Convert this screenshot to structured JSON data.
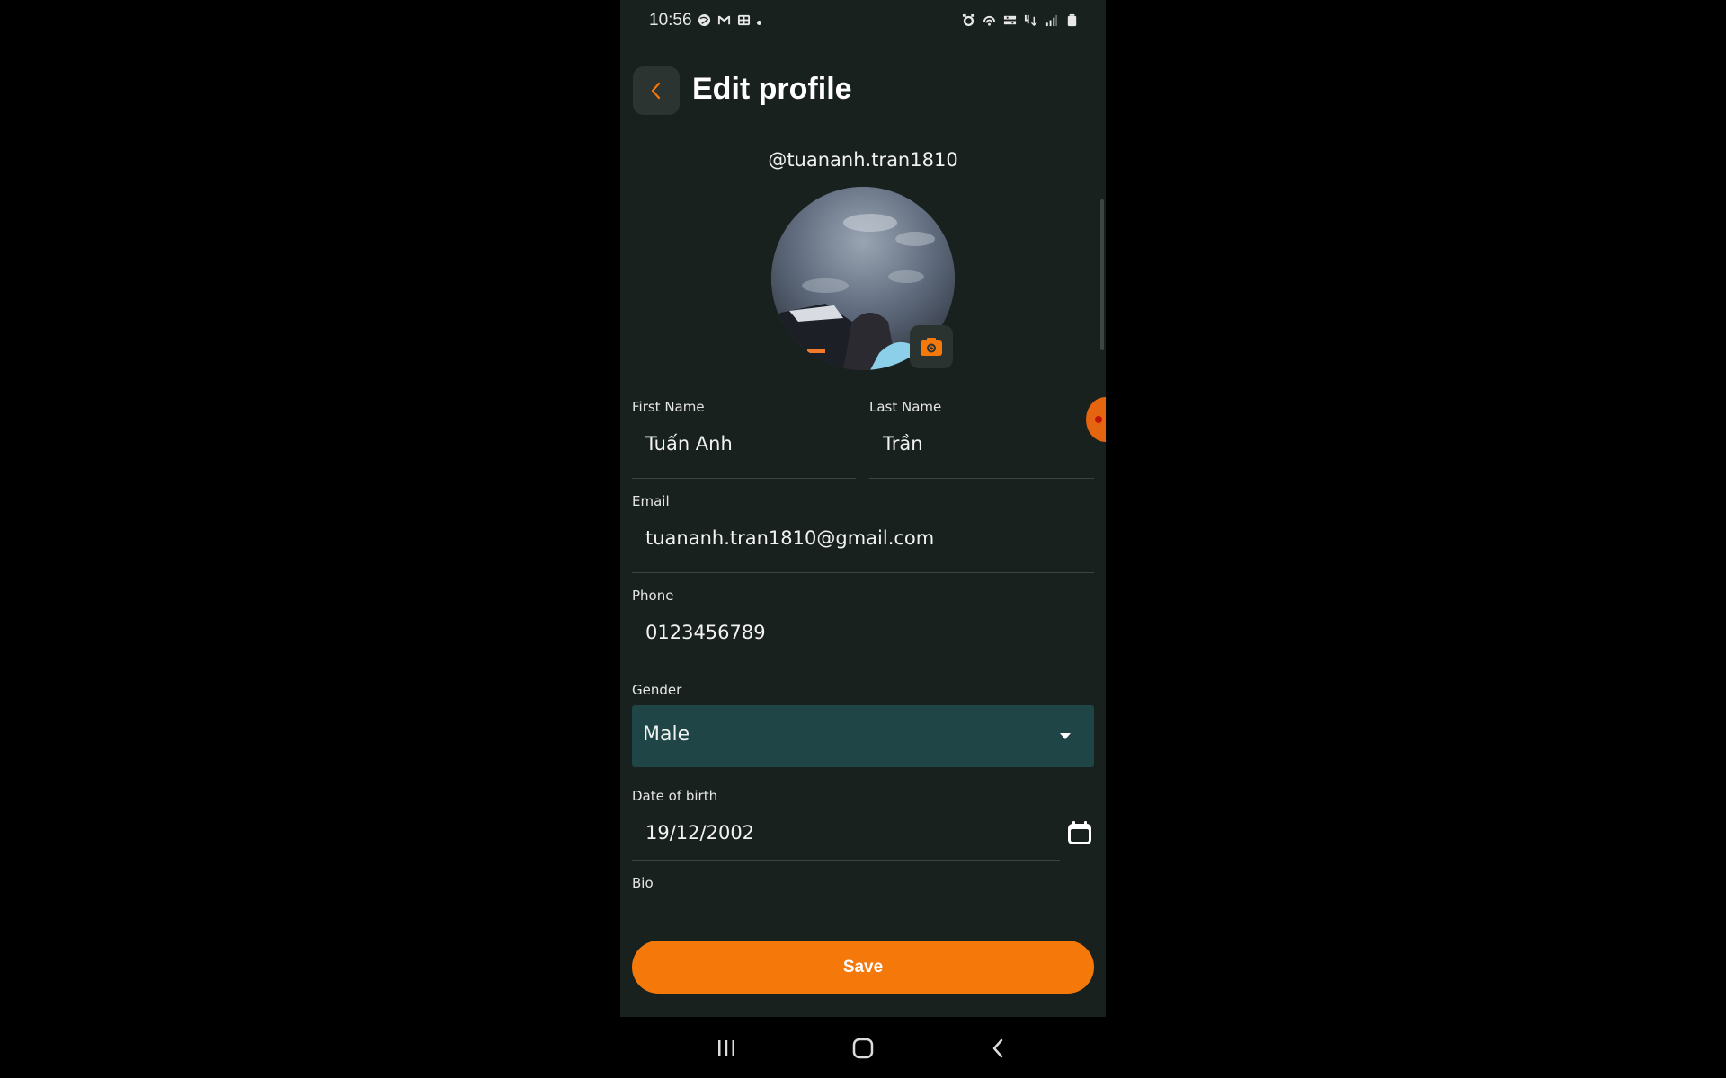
{
  "status_bar": {
    "time": "10:56",
    "left_icons": [
      "globe-icon",
      "gmail-icon",
      "gallery-icon",
      "notification-dot-icon"
    ],
    "right_icons": [
      "alarm-icon",
      "hotspot-icon",
      "volte-icon",
      "4g-data-icon",
      "signal-icon",
      "battery-icon"
    ]
  },
  "header": {
    "title": "Edit profile",
    "back_icon": "chevron-left-icon"
  },
  "profile": {
    "username": "@tuananh.tran1810",
    "camera_icon": "camera-icon"
  },
  "form": {
    "first_name": {
      "label": "First Name",
      "value": "Tuấn Anh"
    },
    "last_name": {
      "label": "Last Name",
      "value": "Trần"
    },
    "email": {
      "label": "Email",
      "value": "tuananh.tran1810@gmail.com"
    },
    "phone": {
      "label": "Phone",
      "value": "0123456789"
    },
    "gender": {
      "label": "Gender",
      "value": "Male"
    },
    "dob": {
      "label": "Date of birth",
      "value": "19/12/2002"
    },
    "bio": {
      "label": "Bio",
      "value": ""
    }
  },
  "actions": {
    "save_label": "Save"
  },
  "colors": {
    "background": "#18211d",
    "accent": "#f5780a",
    "select_bg": "#1f4547"
  },
  "nav_bar": {
    "icons": [
      "recent-apps-icon",
      "home-icon",
      "back-nav-icon"
    ]
  }
}
